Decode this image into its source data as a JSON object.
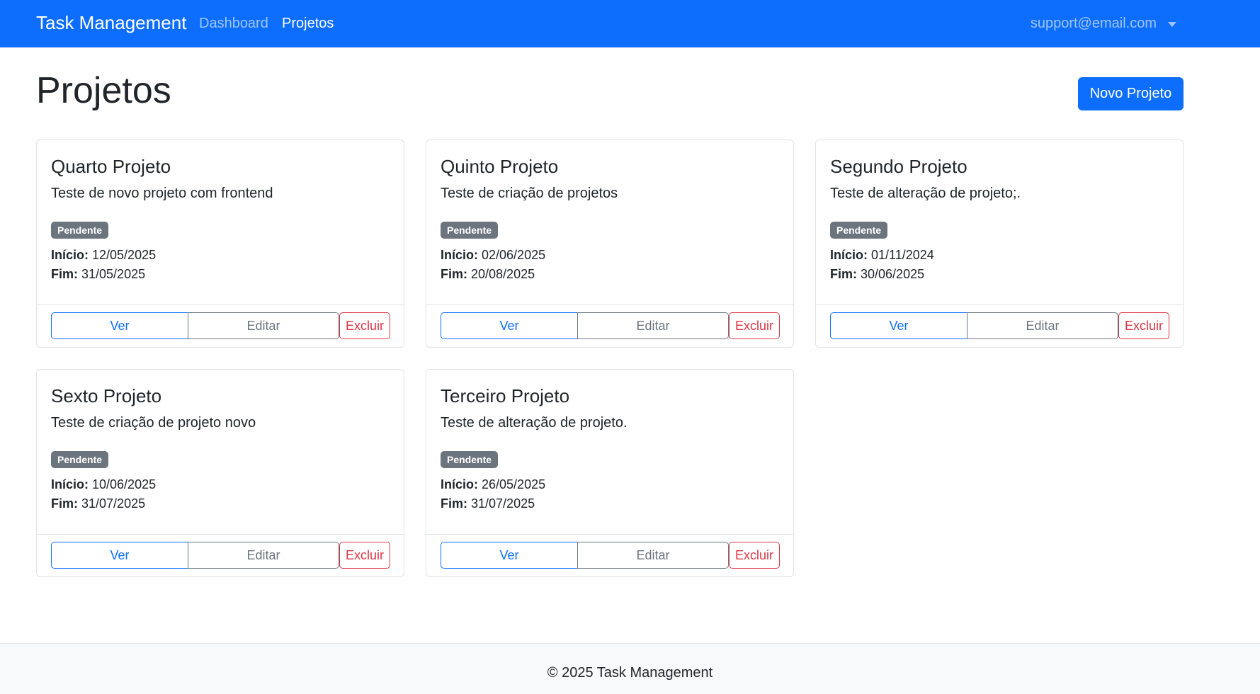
{
  "navbar": {
    "brand": "Task Management",
    "links": [
      {
        "label": "Dashboard"
      },
      {
        "label": "Projetos"
      }
    ],
    "user_email": "support@email.com"
  },
  "page": {
    "title": "Projetos",
    "new_button_label": "Novo Projeto"
  },
  "labels": {
    "start": "Início:",
    "end": "Fim:",
    "view": "Ver",
    "edit": "Editar",
    "delete": "Excluir"
  },
  "projects": [
    {
      "title": "Quarto Projeto",
      "description": "Teste de novo projeto com frontend",
      "status": "Pendente",
      "start": "12/05/2025",
      "end": "31/05/2025"
    },
    {
      "title": "Quinto Projeto",
      "description": "Teste de criação de projetos",
      "status": "Pendente",
      "start": "02/06/2025",
      "end": "20/08/2025"
    },
    {
      "title": "Segundo Projeto",
      "description": "Teste de alteração de projeto;.",
      "status": "Pendente",
      "start": "01/11/2024",
      "end": "30/06/2025"
    },
    {
      "title": "Sexto Projeto",
      "description": "Teste de criação de projeto novo",
      "status": "Pendente",
      "start": "10/06/2025",
      "end": "31/07/2025"
    },
    {
      "title": "Terceiro Projeto",
      "description": "Teste de alteração de projeto.",
      "status": "Pendente",
      "start": "26/05/2025",
      "end": "31/07/2025"
    }
  ],
  "footer": {
    "text": "© 2025 Task Management"
  },
  "colors": {
    "primary": "#0d6efd",
    "secondary": "#6c757d",
    "danger": "#dc3545"
  }
}
